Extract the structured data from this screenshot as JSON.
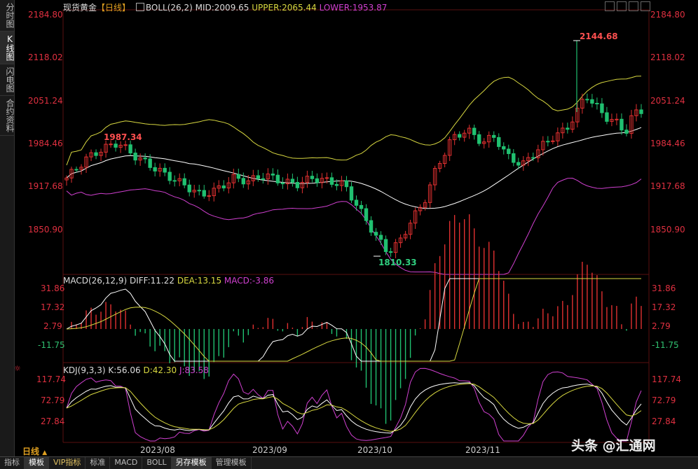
{
  "sidebar": {
    "tabs": [
      {
        "label": "分时图",
        "active": false
      },
      {
        "label": "K线图",
        "active": true
      },
      {
        "label": "闪电图",
        "active": false
      },
      {
        "label": "合约资料",
        "active": false
      }
    ]
  },
  "header": {
    "symbol": "现货黄金",
    "period_tag": "【日线】",
    "indicator": "BOLL(26,2)",
    "mid": "MID:2009.65",
    "upper": "UPPER:2065.44",
    "lower": "LOWER:1953.87"
  },
  "price_axis": [
    "2184.80",
    "2118.02",
    "2051.24",
    "1984.46",
    "1917.68",
    "1850.90"
  ],
  "annotations": {
    "high": "2144.68",
    "low": "1810.33",
    "local_high": "1987.34"
  },
  "macd": {
    "title": "MACD(26,12,9)",
    "diff": "DIFF:11.22",
    "dea": "DEA:13.15",
    "macd": "MACD:-3.86",
    "axis": [
      "31.86",
      "17.32",
      "2.79",
      "-11.75"
    ]
  },
  "kdj": {
    "title": "KDJ(9,3,3)",
    "k": "K:56.06",
    "d": "D:42.30",
    "j": "J:83.58",
    "axis": [
      "117.74",
      "72.79",
      "27.84"
    ]
  },
  "period_label": "日线",
  "dates": [
    "2023/08",
    "2023/09",
    "2023/10",
    "2023/11"
  ],
  "watermark": "头条 @汇通网",
  "bottom_tabs": [
    {
      "label": "指标",
      "active": false,
      "vip": false
    },
    {
      "label": "模板",
      "active": true,
      "vip": false
    },
    {
      "label": "VIP指标",
      "active": false,
      "vip": true
    },
    {
      "label": "标准",
      "active": false,
      "vip": false
    },
    {
      "label": "MACD",
      "active": false,
      "vip": false
    },
    {
      "label": "BOLL",
      "active": false,
      "vip": false
    },
    {
      "label": "另存模板",
      "active": true,
      "vip": false
    },
    {
      "label": "管理模板",
      "active": false,
      "vip": false
    }
  ],
  "colors": {
    "up": "#e03030",
    "down": "#20c070",
    "mid": "#ffffff",
    "upper": "#d8d840",
    "lower": "#d040d0",
    "axis_text": "#e03040"
  }
}
